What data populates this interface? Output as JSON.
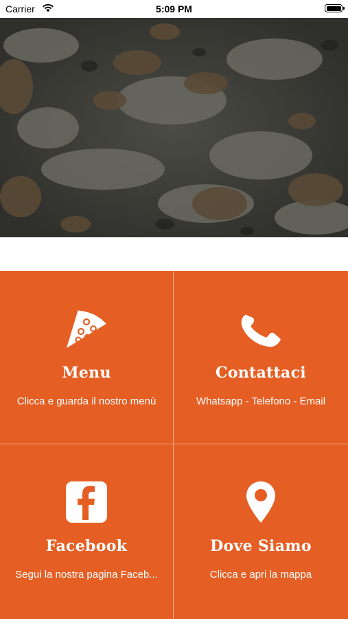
{
  "status_bar": {
    "carrier": "Carrier",
    "time": "5:09 PM",
    "icons": [
      "wifi-icon",
      "battery-icon"
    ]
  },
  "hero": {
    "description_icon": "pizza-photo"
  },
  "colors": {
    "tile_background": "#e55f25",
    "tile_divider": "#f2a889",
    "text": "#ffffff"
  },
  "tiles": [
    {
      "icon": "pizza-slice-icon",
      "title": "Menu",
      "subtitle": "Clicca e guarda il nostro menù"
    },
    {
      "icon": "phone-icon",
      "title": "Contattaci",
      "subtitle": "Whatsapp - Telefono - Email"
    },
    {
      "icon": "facebook-icon",
      "title": "Facebook",
      "subtitle": "Segui la nostra pagina Faceb..."
    },
    {
      "icon": "location-pin-icon",
      "title": "Dove Siamo",
      "subtitle": "Clicca e apri la mappa"
    }
  ]
}
